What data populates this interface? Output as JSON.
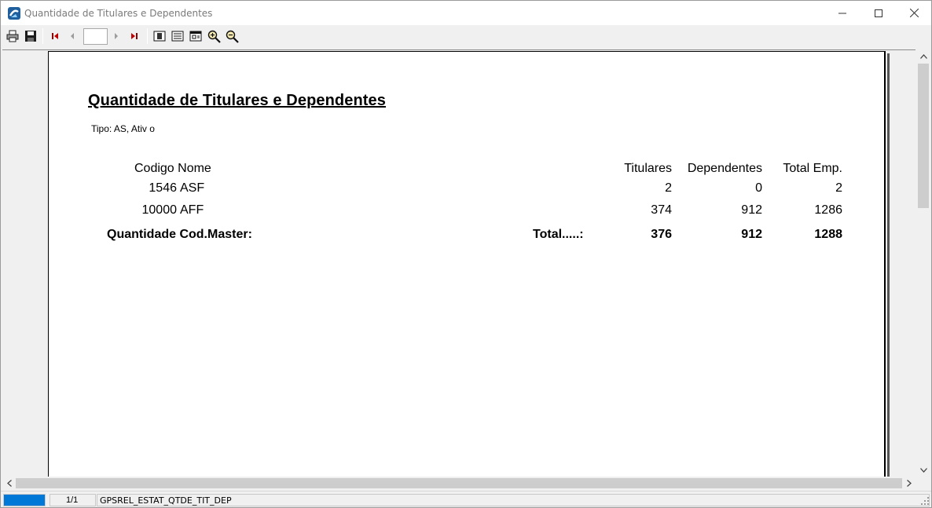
{
  "window": {
    "title": "Quantidade de Titulares e Dependentes"
  },
  "toolbar": {
    "page_value": "",
    "buttons": [
      "print-icon",
      "save-icon",
      "first-page-icon",
      "prev-page-icon",
      "next-page-icon",
      "last-page-icon",
      "whole-page-icon",
      "page-width-icon",
      "hundred-percent-icon",
      "zoom-in-icon",
      "zoom-out-icon"
    ]
  },
  "report": {
    "title": "Quantidade de Titulares e Dependentes",
    "subtitle": "Tipo: AS, Ativ o",
    "columns": {
      "codigo_nome": "Codigo Nome",
      "titulares": "Titulares",
      "dependentes": "Dependentes",
      "total": "Total Emp."
    },
    "rows": [
      {
        "codigo": "1546",
        "nome": "ASF",
        "titulares": "2",
        "dependentes": "0",
        "total": "2"
      },
      {
        "codigo": "10000",
        "nome": "AFF",
        "titulares": "374",
        "dependentes": "912",
        "total": "1286"
      }
    ],
    "footer": {
      "label": "Quantidade Cod.Master:",
      "total_label": "Total.....:",
      "titulares": "376",
      "dependentes": "912",
      "total": "1288"
    }
  },
  "status": {
    "progress": 1.0,
    "page": "1/1",
    "report_name": "GPSREL_ESTAT_QTDE_TIT_DEP"
  },
  "colors": {
    "accent": "#0078d7",
    "window_bg": "#f0f0f0"
  }
}
